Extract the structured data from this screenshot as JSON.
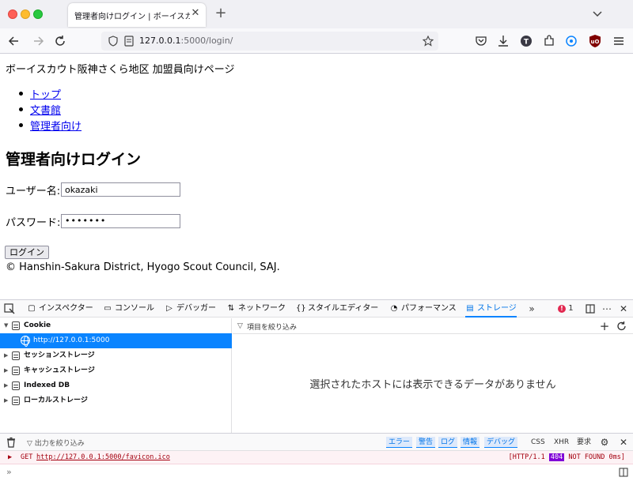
{
  "browser": {
    "tab_title": "管理者向けログイン | ボーイスカウト阪神",
    "tab_close": "✕",
    "new_tab": "+",
    "url_host": "127.0.0.1",
    "url_path": ":5000/login/"
  },
  "page": {
    "site_title": "ボーイスカウト阪神さくら地区 加盟員向けページ",
    "nav": [
      {
        "label": "トップ"
      },
      {
        "label": "文書館"
      },
      {
        "label": "管理者向け"
      }
    ],
    "heading": "管理者向けログイン",
    "username_label": "ユーザー名:",
    "username_value": "okazaki",
    "password_label": "パスワード:",
    "password_value": "•••••••",
    "login_button": "ログイン",
    "footer": "© Hanshin-Sakura District, Hyogo Scout Council, SAJ."
  },
  "devtools": {
    "tabs": [
      {
        "label": "インスペクター",
        "icon": "inspector-icon"
      },
      {
        "label": "コンソール",
        "icon": "console-icon"
      },
      {
        "label": "デバッガー",
        "icon": "debugger-icon"
      },
      {
        "label": "ネットワーク",
        "icon": "network-icon"
      },
      {
        "label": "スタイルエディター",
        "icon": "style-editor-icon"
      },
      {
        "label": "パフォーマンス",
        "icon": "performance-icon"
      },
      {
        "label": "ストレージ",
        "icon": "storage-icon"
      }
    ],
    "error_count": "1",
    "tree": [
      {
        "label": "Cookie"
      },
      {
        "label": "http://127.0.0.1:5000"
      },
      {
        "label": "セッションストレージ"
      },
      {
        "label": "キャッシュストレージ"
      },
      {
        "label": "Indexed DB"
      },
      {
        "label": "ローカルストレージ"
      }
    ],
    "filter_placeholder": "項目を絞り込み",
    "empty_message": "選択されたホストには表示できるデータがありません",
    "console": {
      "filter_placeholder": "出力を絞り込み",
      "levels": [
        "エラー",
        "警告",
        "ログ",
        "情報",
        "デバッグ"
      ],
      "extras": [
        "CSS",
        "XHR",
        "要求"
      ],
      "log_method": "GET",
      "log_url": "http://127.0.0.1:5000/favicon.ico",
      "log_status_prefix": "[HTTP/1.1",
      "log_status_code": "404",
      "log_status_suffix": "NOT FOUND 0ms]",
      "prompt": "»"
    }
  },
  "colors": {
    "accent": "#0a84ff",
    "link": "#0000ee",
    "error": "#e22850"
  }
}
